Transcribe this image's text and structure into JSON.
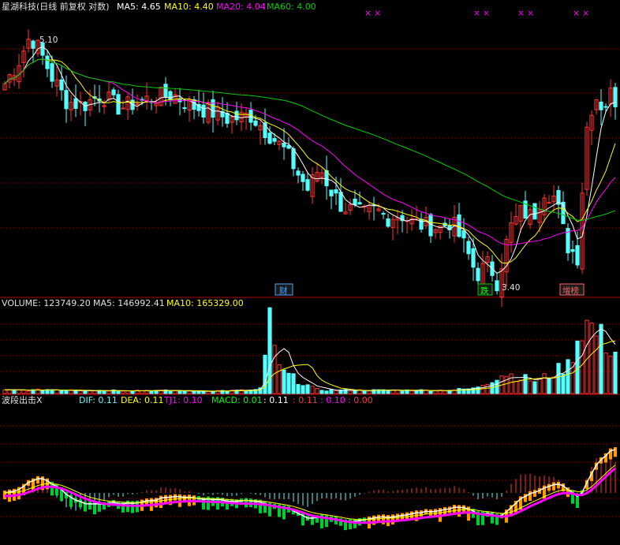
{
  "header": {
    "title": "星湖科技(日线 前复权 对数)",
    "ma5": "MA5: 4.65",
    "ma10": "MA10: 4.40",
    "ma20": "MA20: 4.04",
    "ma60": "MA60: 4.00"
  },
  "volume_header": {
    "volume": "VOLUME: 123749.20",
    "ma5": "MA5: 146992.41",
    "ma10": "MA10: 165329.00"
  },
  "indicator_header": {
    "name": "波段出击X",
    "dif": "DIF: 0.11",
    "dea": "DEA: 0.11",
    "tj1": "TJ1: 0.10",
    "macd": "MACD: 0.01",
    "v1": ": 0.11",
    "v2": ": 0.11",
    "v3": ": 0.10",
    "v4": ": 0.00"
  },
  "annotations": {
    "high_label": "5.10",
    "low_label": "3.40",
    "tag1": "财",
    "tag2": "跌",
    "tag3": "增榜",
    "markers": "× ×"
  },
  "colors": {
    "up": "#ff3232",
    "down": "#54ffff",
    "ma5": "#ffffff",
    "ma10": "#ffff00",
    "ma20": "#ff00ff",
    "ma60": "#00cc00",
    "grid": "#8b0000",
    "dif": "#ffffff",
    "dea": "#ffff00",
    "tj1": "#ff00ff",
    "macd": "#00ff00"
  },
  "chart_data": {
    "type": "candlestick",
    "price_anchors": [
      [
        0,
        4.68
      ],
      [
        10,
        4.85
      ],
      [
        18,
        5.05
      ],
      [
        24,
        4.95
      ],
      [
        34,
        4.72
      ],
      [
        44,
        4.55
      ],
      [
        56,
        4.52
      ],
      [
        68,
        4.6
      ],
      [
        82,
        4.5
      ],
      [
        96,
        4.55
      ],
      [
        108,
        4.58
      ],
      [
        120,
        4.6
      ],
      [
        132,
        4.52
      ],
      [
        146,
        4.48
      ],
      [
        160,
        4.42
      ],
      [
        175,
        4.45
      ],
      [
        190,
        4.3
      ],
      [
        200,
        4.2
      ],
      [
        209,
        4.05
      ],
      [
        216,
        3.95
      ],
      [
        224,
        4.1
      ],
      [
        232,
        3.95
      ],
      [
        240,
        3.85
      ],
      [
        248,
        3.82
      ],
      [
        256,
        3.8
      ],
      [
        264,
        3.83
      ],
      [
        272,
        3.78
      ],
      [
        282,
        3.8
      ],
      [
        290,
        3.75
      ],
      [
        300,
        3.73
      ],
      [
        310,
        3.72
      ],
      [
        318,
        3.76
      ],
      [
        328,
        3.6
      ],
      [
        336,
        3.45
      ],
      [
        345,
        3.52
      ],
      [
        350,
        3.4
      ],
      [
        360,
        3.72
      ],
      [
        368,
        3.82
      ],
      [
        376,
        3.78
      ],
      [
        384,
        3.95
      ],
      [
        392,
        3.9
      ],
      [
        400,
        3.62
      ],
      [
        408,
        3.55
      ],
      [
        414,
        4.35
      ],
      [
        420,
        4.6
      ],
      [
        426,
        4.5
      ],
      [
        432,
        4.62
      ],
      [
        438,
        4.48
      ]
    ],
    "volume_anchors": [
      [
        0,
        0.04
      ],
      [
        40,
        0.04
      ],
      [
        60,
        0.05
      ],
      [
        120,
        0.04
      ],
      [
        180,
        0.04
      ],
      [
        240,
        0.03
      ],
      [
        320,
        0.04
      ],
      [
        334,
        0.07
      ],
      [
        340,
        1.0
      ],
      [
        346,
        0.8
      ],
      [
        352,
        0.3
      ],
      [
        370,
        0.2
      ],
      [
        400,
        0.05
      ],
      [
        420,
        0.04
      ],
      [
        500,
        0.04
      ],
      [
        560,
        0.04
      ],
      [
        600,
        0.06
      ],
      [
        640,
        0.25
      ],
      [
        680,
        0.15
      ],
      [
        720,
        0.35
      ],
      [
        740,
        0.9
      ],
      [
        760,
        0.7
      ],
      [
        786,
        0.45
      ]
    ],
    "ylim": [
      3.35,
      5.2
    ],
    "high_label": 5.1,
    "low_label": 3.4
  }
}
